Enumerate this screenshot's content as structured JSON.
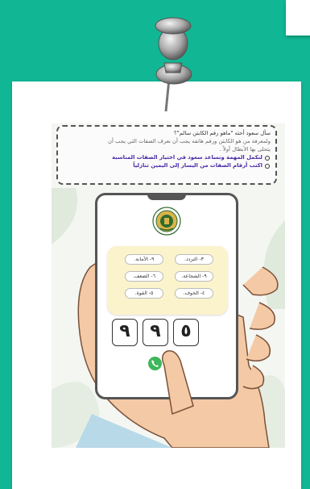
{
  "instructions": {
    "line1": "سأل سعود أخته \"ماهو رقم الكابتن سالم\"؟",
    "line2": "ولمعرفة من هو الكابتن ورقم هاتفه يجب أن نعرف الصفات التي يجب أن",
    "line3": "يتحلى بها الأبطال أولاً .",
    "task1": "لنكمل المهمة ونساعد سعود في اختيار الصفات المناسبة",
    "task2": "اكتب أرقام الصفات من اليسار إلى اليمين تنازلياً"
  },
  "traits": [
    {
      "label": "٣- التردد."
    },
    {
      "label": "٩- الأمانة."
    },
    {
      "label": "٩- الشجاعة."
    },
    {
      "label": "٦- الضعف."
    },
    {
      "label": "٤- الخوف."
    },
    {
      "label": "٥- القوة."
    }
  ],
  "digits": [
    "٩",
    "٩",
    "٥"
  ],
  "colors": {
    "background": "#11b794",
    "call": "#3eb65a",
    "task_text": "#4b2aa7",
    "trait_panel": "#fbf3cc"
  }
}
